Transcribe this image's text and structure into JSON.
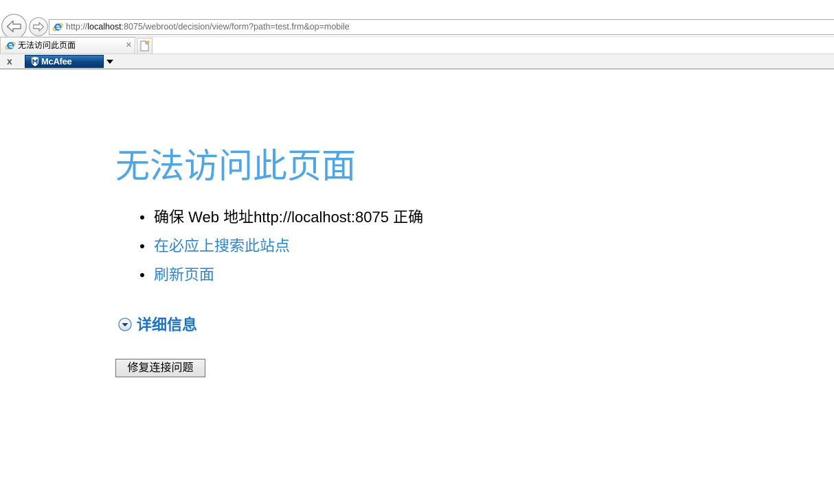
{
  "browser": {
    "url_prefix": "http://",
    "url_host": "localhost",
    "url_rest": ":8075/webroot/decision/view/form?path=test.frm&op=mobile",
    "tab_title": "无法访问此页面",
    "tab_close": "×",
    "toolbar_close": "x",
    "mcafee_label": "McAfee"
  },
  "page": {
    "heading": "无法访问此页面",
    "bullets": [
      {
        "text": "确保 Web 地址http://localhost:8075 正确"
      },
      {
        "text": "在必应上搜索此站点"
      },
      {
        "text": "刷新页面"
      }
    ],
    "details_label": "详细信息",
    "fix_button_label": "修复连接问题"
  },
  "icons": {
    "back": "back-arrow-icon",
    "forward": "forward-arrow-icon",
    "site": "ie-icon",
    "new_tab": "new-tab-icon",
    "mcafee": "mcafee-shield-icon",
    "dropdown": "dropdown-arrow-icon",
    "details": "chevron-down-circle-icon"
  },
  "colors": {
    "heading": "#4ea6e4",
    "link": "#2b86d6",
    "details": "#1a73c8",
    "mcafee": "#0d4585"
  }
}
